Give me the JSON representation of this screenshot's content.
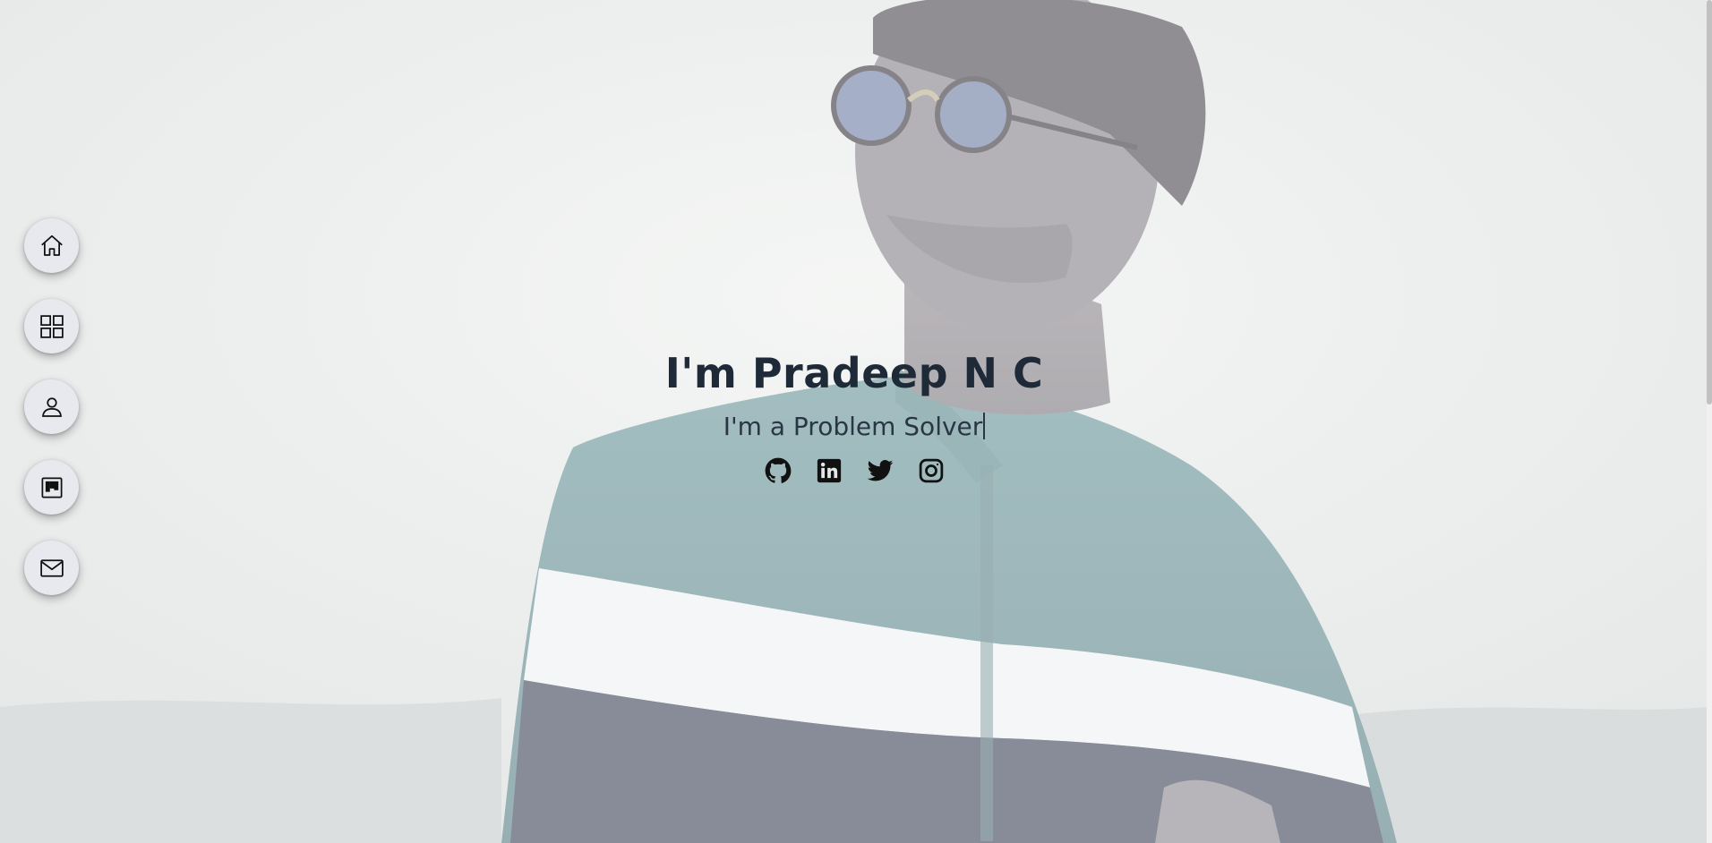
{
  "hero": {
    "title": "I'm Pradeep N C",
    "subtitle": "I'm a Problem Solver"
  },
  "side_nav": {
    "items": [
      {
        "icon": "home-icon"
      },
      {
        "icon": "grid-icon"
      },
      {
        "icon": "user-icon"
      },
      {
        "icon": "kanban-icon"
      },
      {
        "icon": "mail-icon"
      }
    ]
  },
  "social": {
    "items": [
      {
        "icon": "github-icon"
      },
      {
        "icon": "linkedin-icon"
      },
      {
        "icon": "twitter-icon"
      },
      {
        "icon": "instagram-icon"
      }
    ]
  },
  "colors": {
    "title": "#1f2a38",
    "nav_button_bg": "#e8e9ee",
    "shirt_teal": "#5a8c91",
    "shirt_navy": "#3a3f55"
  }
}
